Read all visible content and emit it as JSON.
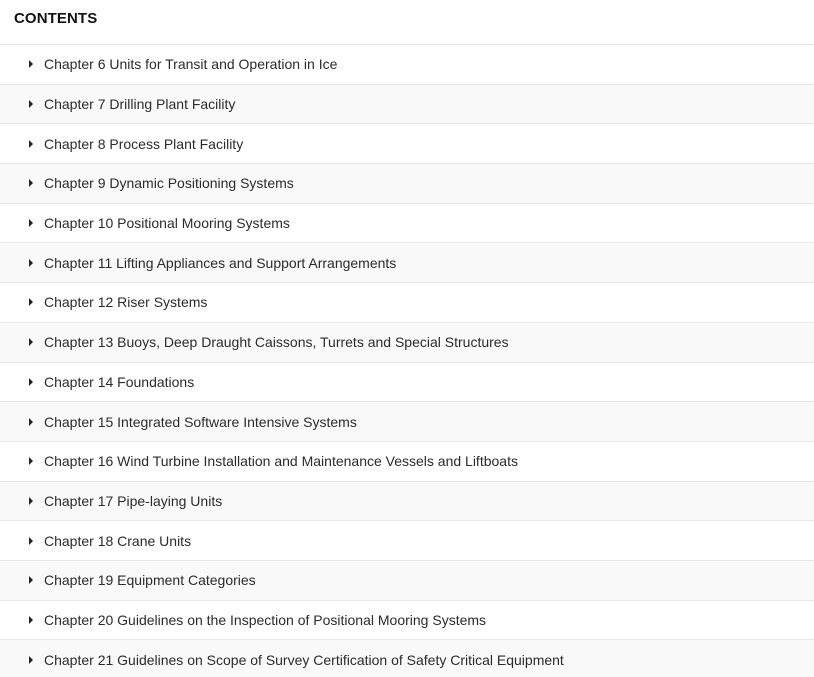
{
  "header": {
    "title": "CONTENTS"
  },
  "toc": {
    "items": [
      {
        "label": "Chapter 6 Units for Transit and Operation in Ice"
      },
      {
        "label": "Chapter 7 Drilling Plant Facility"
      },
      {
        "label": "Chapter 8 Process Plant Facility"
      },
      {
        "label": "Chapter 9 Dynamic Positioning Systems"
      },
      {
        "label": "Chapter 10 Positional Mooring Systems"
      },
      {
        "label": "Chapter 11 Lifting Appliances and Support Arrangements"
      },
      {
        "label": "Chapter 12 Riser Systems"
      },
      {
        "label": "Chapter 13 Buoys, Deep Draught Caissons, Turrets and Special Structures"
      },
      {
        "label": "Chapter 14 Foundations"
      },
      {
        "label": "Chapter 15 Integrated Software Intensive Systems"
      },
      {
        "label": "Chapter 16 Wind Turbine Installation and Maintenance Vessels and Liftboats"
      },
      {
        "label": "Chapter 17 Pipe-laying Units"
      },
      {
        "label": "Chapter 18 Crane Units"
      },
      {
        "label": "Chapter 19 Equipment Categories"
      },
      {
        "label": "Chapter 20 Guidelines on the Inspection of Positional Mooring Systems"
      },
      {
        "label": "Chapter 21 Guidelines on Scope of Survey Certification of Safety Critical Equipment"
      }
    ]
  },
  "icons": {
    "expand": "caret-right-icon"
  },
  "colors": {
    "row_alt_bg": "#f9f9f9",
    "divider": "#e8e8e8",
    "text": "#2b2b2b"
  }
}
